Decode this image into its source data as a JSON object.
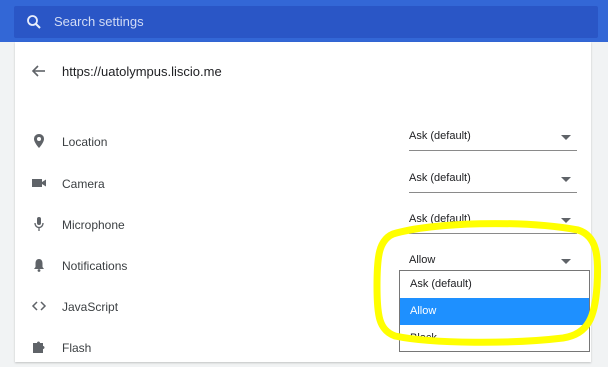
{
  "search": {
    "placeholder": "Search settings",
    "icon": "search-icon"
  },
  "site": {
    "url": "https://uatolympus.liscio.me",
    "back_icon": "arrow-left-icon"
  },
  "permissions": [
    {
      "label": "Location",
      "value": "Ask (default)",
      "icon": "location-pin-icon"
    },
    {
      "label": "Camera",
      "value": "Ask (default)",
      "icon": "camera-icon"
    },
    {
      "label": "Microphone",
      "value": "Ask (default)",
      "icon": "microphone-icon"
    },
    {
      "label": "Notifications",
      "value": "Allow",
      "icon": "bell-icon"
    },
    {
      "label": "JavaScript",
      "value": "",
      "icon": "code-brackets-icon"
    },
    {
      "label": "Flash",
      "value": "",
      "icon": "puzzle-piece-icon"
    }
  ],
  "dropdown": {
    "options": [
      "Ask (default)",
      "Allow",
      "Block"
    ],
    "selected": "Allow"
  },
  "colors": {
    "topbar": "#3367d6",
    "selected_option": "#1e90ff",
    "highlight": "#ffff00"
  }
}
